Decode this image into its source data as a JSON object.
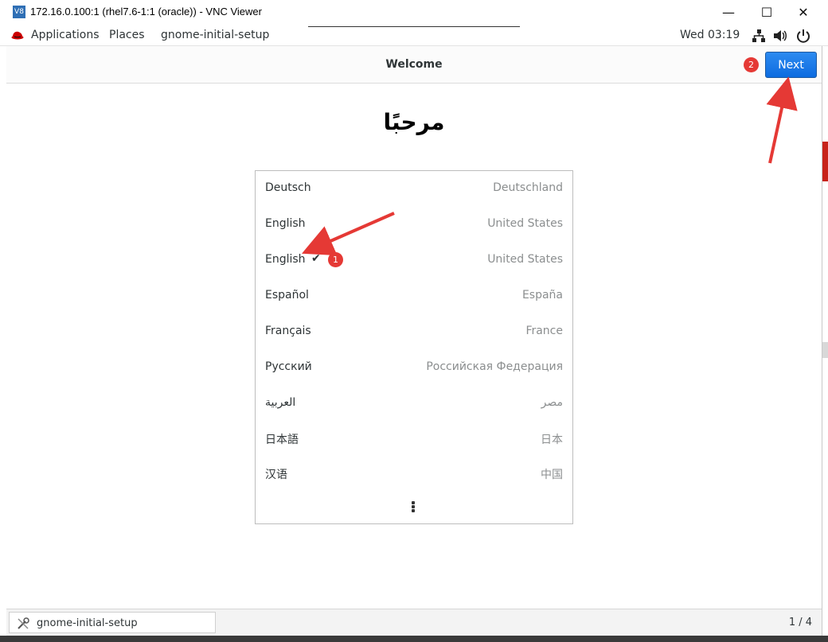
{
  "window": {
    "title": "172.16.0.100:1 (rhel7.6-1:1 (oracle)) - VNC Viewer",
    "app_icon_text": "V8",
    "minimize_glyph": "—",
    "maximize_glyph": "☐",
    "close_glyph": "✕"
  },
  "topbar": {
    "applications": "Applications",
    "places": "Places",
    "app_name": "gnome-initial-setup",
    "clock": "Wed 03:19"
  },
  "header": {
    "title": "Welcome",
    "next_label": "Next"
  },
  "main": {
    "welcome_text": "مرحبًا",
    "languages": [
      {
        "name": "Deutsch",
        "region": "Deutschland",
        "selected": false
      },
      {
        "name": "English",
        "region": "United States",
        "selected": false
      },
      {
        "name": "English",
        "region": "United States",
        "selected": true
      },
      {
        "name": "Español",
        "region": "España",
        "selected": false
      },
      {
        "name": "Français",
        "region": "France",
        "selected": false
      },
      {
        "name": "Русский",
        "region": "Российская Федерация",
        "selected": false
      },
      {
        "name": "العربية",
        "region": "مصر",
        "selected": false
      },
      {
        "name": "日本語",
        "region": "日本",
        "selected": false
      },
      {
        "name": "汉语",
        "region": "中国",
        "selected": false
      }
    ],
    "check_glyph": "✔"
  },
  "statusbar": {
    "task_label": "gnome-initial-setup",
    "page_counter": "1 / 4"
  },
  "annotations": {
    "badge_1": "1",
    "badge_2": "2",
    "color": "#e53935"
  },
  "colors": {
    "accent": "#1a7ae8",
    "redhat": "#cc0000"
  },
  "icons": {
    "redhat_logo": "redhat-icon",
    "network": "network-icon",
    "volume": "volume-icon",
    "power": "power-icon",
    "task": "tools-icon",
    "more": "vertical-ellipsis-icon"
  }
}
